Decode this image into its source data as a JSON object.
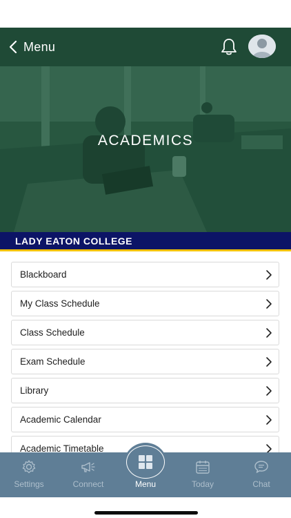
{
  "header": {
    "back_label": "Menu",
    "back_icon": "chevron-left-icon",
    "notification_icon": "bell-icon",
    "avatar_icon": "user-avatar-icon",
    "background_color": "#1f4a36"
  },
  "hero": {
    "title": "ACADEMICS"
  },
  "college": {
    "name": "LADY EATON COLLEGE",
    "bar_color": "#0c1466",
    "accent_color": "#f2c200"
  },
  "menu": {
    "items": [
      {
        "label": "Blackboard"
      },
      {
        "label": "My Class Schedule"
      },
      {
        "label": "Class Schedule"
      },
      {
        "label": "Exam Schedule"
      },
      {
        "label": "Library"
      },
      {
        "label": "Academic Calendar"
      },
      {
        "label": "Academic Timetable"
      }
    ],
    "chevron_icon": "chevron-right-icon"
  },
  "tabbar": {
    "background_color": "#5f7e96",
    "tabs": [
      {
        "label": "Settings",
        "icon": "gear-icon"
      },
      {
        "label": "Connect",
        "icon": "megaphone-icon"
      },
      {
        "label": "Menu",
        "icon": "grid-icon"
      },
      {
        "label": "Today",
        "icon": "calendar-icon"
      },
      {
        "label": "Chat",
        "icon": "chat-bubble-icon"
      }
    ],
    "active": "Menu"
  }
}
